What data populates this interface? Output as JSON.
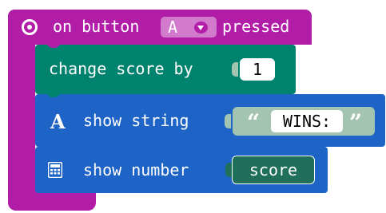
{
  "event": {
    "prefix": "on button",
    "button_value": "A",
    "suffix": "pressed",
    "icon": "radio-button-icon",
    "color": "#B21DA8"
  },
  "change_score": {
    "label": "change score by",
    "value": "1",
    "color": "#00836E"
  },
  "show_string": {
    "icon": "letter-a-icon",
    "icon_glyph": "A",
    "label": "show string",
    "open_quote": "“",
    "value": "WINS:",
    "close_quote": "”",
    "color": "#1E64C7"
  },
  "show_number": {
    "icon": "calculator-icon",
    "label": "show number",
    "variable": "score",
    "color": "#1E64C7"
  }
}
